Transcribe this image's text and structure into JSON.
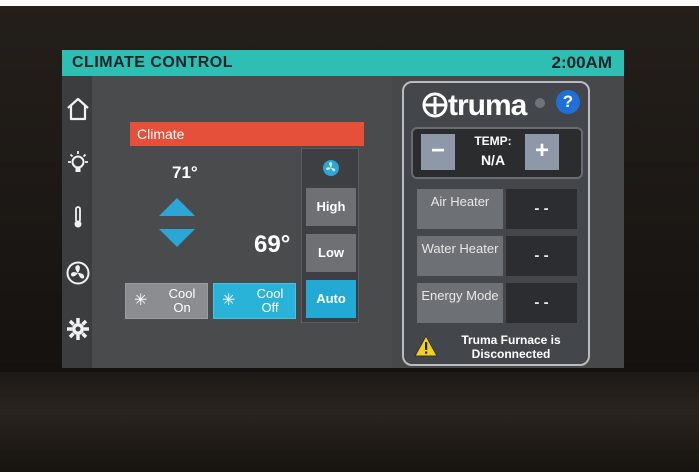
{
  "header": {
    "title": "CLIMATE CONTROL",
    "time": "2:00AM"
  },
  "sidebar": {
    "items": [
      {
        "icon": "home-icon"
      },
      {
        "icon": "light-bulb-icon"
      },
      {
        "icon": "thermometer-icon"
      },
      {
        "icon": "fan-icon"
      },
      {
        "icon": "gear-icon"
      }
    ]
  },
  "climate": {
    "label": "Climate",
    "setpoint": "71°",
    "current_temp": "69°",
    "cool_on_label": "Cool On",
    "cool_off_label": "Cool Off",
    "fan": {
      "high": "High",
      "low": "Low",
      "auto": "Auto",
      "selected": "Auto"
    },
    "mode_selected": "Cool Off"
  },
  "truma": {
    "logo": "truma",
    "help": "?",
    "temp_label": "TEMP:",
    "temp_value": "N/A",
    "minus": "−",
    "plus": "+",
    "rows": [
      {
        "name": "Air Heater",
        "value": "- -"
      },
      {
        "name": "Water Heater",
        "value": "- -"
      },
      {
        "name": "Energy Mode",
        "value": "- -"
      }
    ],
    "warning": "Truma Furnace is Disconnected"
  },
  "colors": {
    "title_bar": "#2dbfb4",
    "climate_label": "#e4503a",
    "active_blue": "#22a9d4",
    "help_blue": "#1f6fd9"
  }
}
